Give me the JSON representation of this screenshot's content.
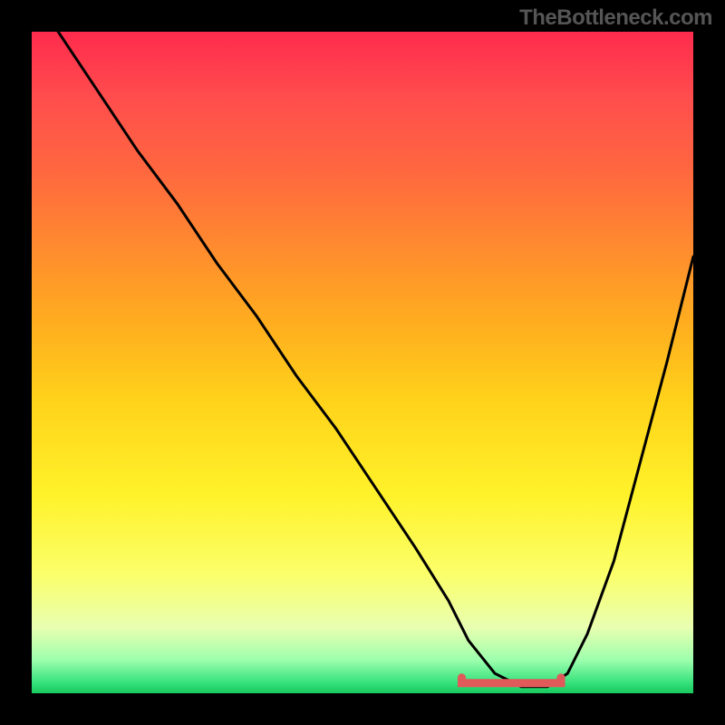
{
  "watermark": "TheBottleneck.com",
  "chart_data": {
    "type": "line",
    "title": "",
    "xlabel": "",
    "ylabel": "",
    "xlim": [
      0,
      100
    ],
    "ylim": [
      0,
      100
    ],
    "grid": false,
    "legend": "none",
    "background": "rainbow-vertical-gradient",
    "series": [
      {
        "name": "bottleneck-curve",
        "color": "#000000",
        "x": [
          4,
          8,
          12,
          16,
          22,
          28,
          34,
          40,
          46,
          52,
          58,
          63,
          66,
          70,
          74,
          78,
          81,
          84,
          88,
          92,
          96,
          100
        ],
        "y": [
          100,
          94,
          88,
          82,
          74,
          65,
          57,
          48,
          40,
          31,
          22,
          14,
          8,
          3,
          1,
          1,
          3,
          9,
          20,
          35,
          50,
          66
        ]
      },
      {
        "name": "optimal-range-marker",
        "color": "#e05a5a",
        "x": [
          65,
          80
        ],
        "y": [
          1,
          1
        ]
      }
    ],
    "gradient_stops": [
      {
        "pos": 0,
        "color": "#ff2b4d"
      },
      {
        "pos": 10,
        "color": "#ff4d4d"
      },
      {
        "pos": 22,
        "color": "#ff6a3e"
      },
      {
        "pos": 33,
        "color": "#ff8c2e"
      },
      {
        "pos": 44,
        "color": "#ffad1f"
      },
      {
        "pos": 56,
        "color": "#ffd31a"
      },
      {
        "pos": 70,
        "color": "#fff22a"
      },
      {
        "pos": 82,
        "color": "#fbff6a"
      },
      {
        "pos": 90,
        "color": "#e9ffb0"
      },
      {
        "pos": 95,
        "color": "#9cffad"
      },
      {
        "pos": 98.5,
        "color": "#33e07a"
      },
      {
        "pos": 100,
        "color": "#19c95e"
      }
    ]
  }
}
